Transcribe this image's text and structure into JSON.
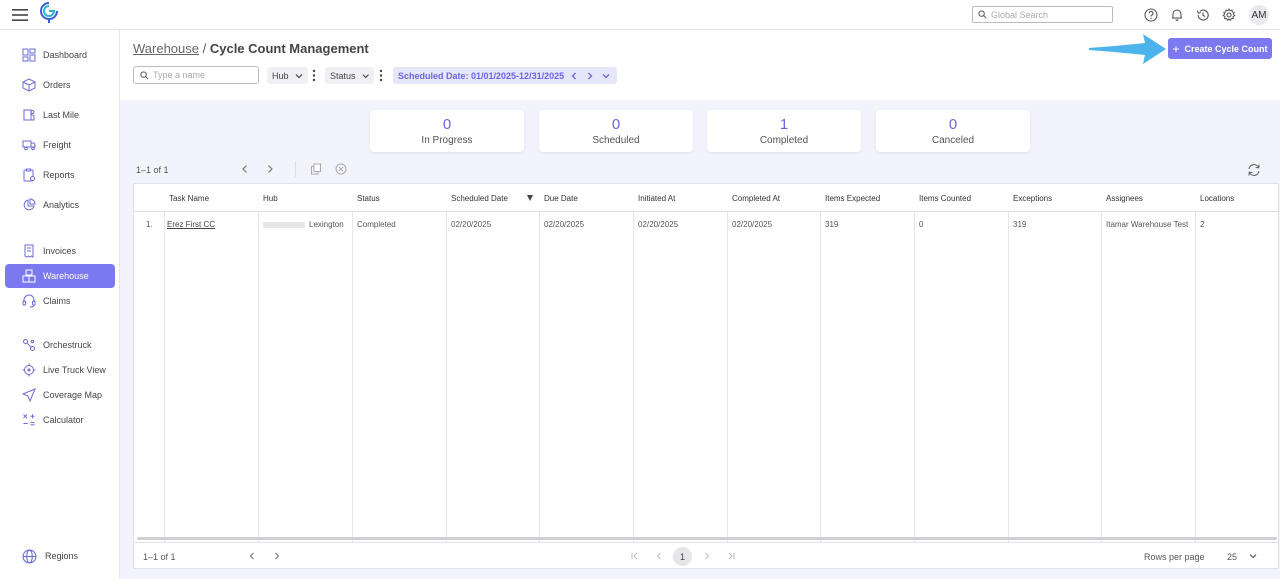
{
  "topbar": {
    "global_search_placeholder": "Global Search",
    "user_initials": "AM"
  },
  "sidebar": {
    "items": [
      {
        "label": "Dashboard",
        "icon": "dashboard-icon"
      },
      {
        "label": "Orders",
        "icon": "box-icon"
      },
      {
        "label": "Last Mile",
        "icon": "delivery-icon"
      },
      {
        "label": "Freight",
        "icon": "truck-icon"
      },
      {
        "label": "Reports",
        "icon": "report-icon"
      },
      {
        "label": "Analytics",
        "icon": "analytics-icon"
      },
      {
        "label": "Invoices",
        "icon": "invoice-icon"
      },
      {
        "label": "Warehouse",
        "icon": "warehouse-icon",
        "active": true
      },
      {
        "label": "Claims",
        "icon": "headset-icon"
      },
      {
        "label": "Orchestruck",
        "icon": "orchestrate-icon"
      },
      {
        "label": "Live Truck View",
        "icon": "target-icon"
      },
      {
        "label": "Coverage Map",
        "icon": "navigation-icon"
      },
      {
        "label": "Calculator",
        "icon": "calculator-icon"
      }
    ],
    "bottom": {
      "label": "Regions",
      "icon": "globe-icon"
    }
  },
  "header": {
    "breadcrumb_parent": "Warehouse",
    "breadcrumb_separator": " / ",
    "breadcrumb_current": "Cycle Count Management",
    "name_search_placeholder": "Type a name",
    "hub_filter": "Hub",
    "status_filter": "Status",
    "date_filter": "Scheduled Date: 01/01/2025-12/31/2025",
    "create_button": "Create Cycle Count"
  },
  "stats": [
    {
      "value": "0",
      "label": "In Progress"
    },
    {
      "value": "0",
      "label": "Scheduled"
    },
    {
      "value": "1",
      "label": "Completed"
    },
    {
      "value": "0",
      "label": "Canceled"
    }
  ],
  "toolbar": {
    "pagination": "1–1 of 1"
  },
  "table": {
    "columns": [
      "Task Name",
      "Hub",
      "Status",
      "Scheduled Date",
      "Due Date",
      "Initiated At",
      "Completed At",
      "Items Expected",
      "Items Counted",
      "Exceptions",
      "Assignees",
      "Locations"
    ],
    "rows": [
      {
        "index": "1.",
        "task_name": "Erez First CC",
        "hub": "Lexington",
        "status": "Completed",
        "scheduled_date": "02/20/2025",
        "due_date": "02/20/2025",
        "initiated_at": "02/20/2025",
        "completed_at": "02/20/2025",
        "items_expected": "319",
        "items_counted": "0",
        "exceptions": "319",
        "assignees": "Itamar Warehouse Test",
        "locations": "2"
      }
    ]
  },
  "footer": {
    "pagination": "1–1 of 1",
    "current_page": "1",
    "rows_per_page_label": "Rows per page",
    "rows_per_page_value": "25"
  },
  "colors": {
    "accent": "#7b78f0",
    "accent_text": "#6a66e0",
    "arrow": "#4db3ec"
  }
}
